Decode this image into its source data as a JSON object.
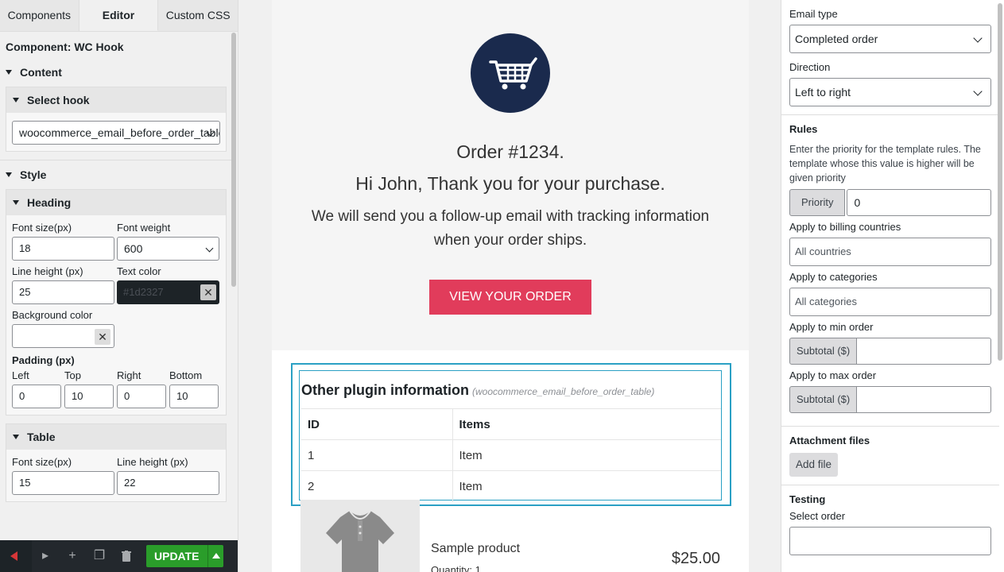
{
  "tabs": [
    "Components",
    "Editor",
    "Custom CSS"
  ],
  "left": {
    "component_title": "Component: WC Hook",
    "content_label": "Content",
    "select_hook_label": "Select hook",
    "hook_value": "woocommerce_email_before_order_table",
    "style_label": "Style",
    "heading": {
      "label": "Heading",
      "font_size_label": "Font size(px)",
      "font_size": "18",
      "font_weight_label": "Font weight",
      "font_weight": "600",
      "line_height_label": "Line height (px)",
      "line_height": "25",
      "text_color_label": "Text color",
      "text_color": "#1d2327",
      "bg_color_label": "Background color",
      "padding_label": "Padding (px)",
      "pad_left_label": "Left",
      "pad_top_label": "Top",
      "pad_right_label": "Right",
      "pad_bottom_label": "Bottom",
      "pad_left": "0",
      "pad_top": "10",
      "pad_right": "0",
      "pad_bottom": "10"
    },
    "table": {
      "label": "Table",
      "font_size_label": "Font size(px)",
      "font_size": "15",
      "line_height_label": "Line height (px)",
      "line_height": "22"
    },
    "update_label": "UPDATE"
  },
  "email": {
    "order_number": "Order #1234.",
    "thanks": "Hi John, Thank you for your purchase.",
    "followup": "We will send you a follow-up email with tracking information when your order ships.",
    "cta": "VIEW YOUR ORDER",
    "hook_heading": "Other plugin information",
    "hook_name": "(woocommerce_email_before_order_table)",
    "table_headers": [
      "ID",
      "Items"
    ],
    "table_rows": [
      [
        "1",
        "Item"
      ],
      [
        "2",
        "Item"
      ]
    ],
    "product_name": "Sample product",
    "product_qty": "Quantity: 1",
    "product_price": "$25.00",
    "colors": {
      "circle": "#1a2a4d",
      "cta": "#e13c5b",
      "hook_border": "#2aa0c4"
    }
  },
  "right": {
    "email_type_label": "Email type",
    "email_type": "Completed order",
    "direction_label": "Direction",
    "direction": "Left to right",
    "rules_label": "Rules",
    "rules_desc": "Enter the priority for the template rules. The template whose this value is higher will be given priority",
    "priority_label": "Priority",
    "priority": "0",
    "billing_label": "Apply to billing countries",
    "billing_placeholder": "All countries",
    "categories_label": "Apply to categories",
    "categories_placeholder": "All categories",
    "min_order_label": "Apply to min order",
    "max_order_label": "Apply to max order",
    "subtotal_label": "Subtotal ($)",
    "attachment_label": "Attachment files",
    "add_file_label": "Add file",
    "testing_label": "Testing",
    "select_order_label": "Select order"
  }
}
